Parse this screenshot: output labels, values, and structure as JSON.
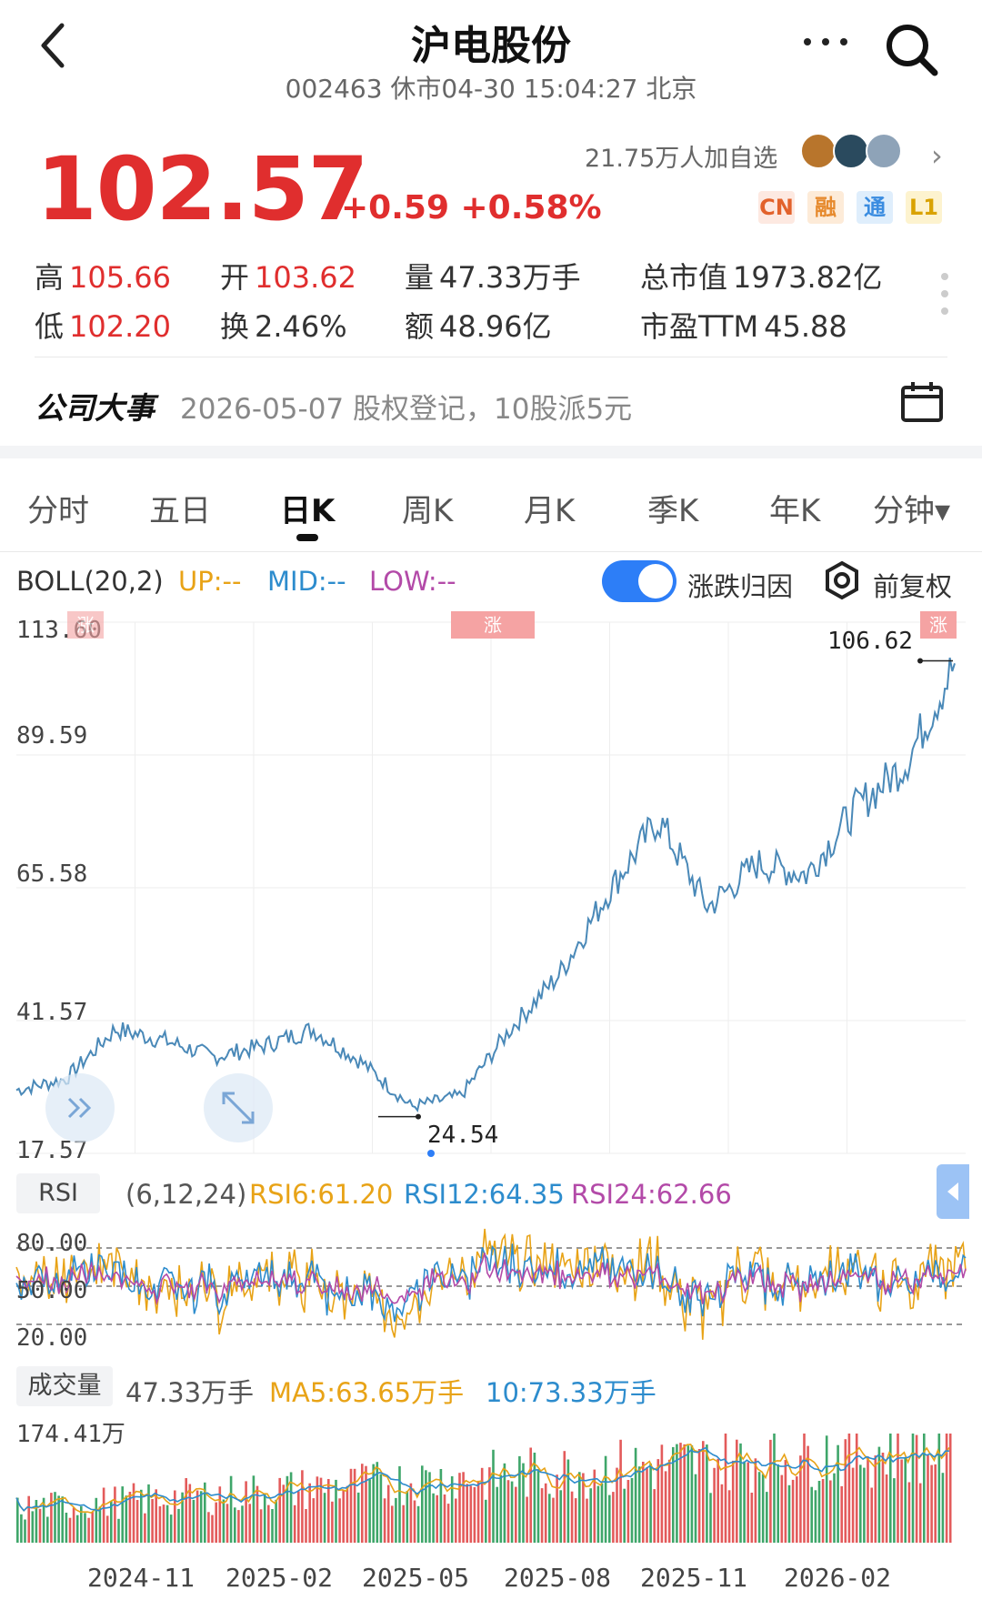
{
  "header": {
    "title": "沪电股份",
    "subtitle": "002463 休市04-30 15:04:27 北京"
  },
  "quote": {
    "price": "102.57",
    "change": "+0.59 +0.58%",
    "followers": "21.75万人加自选",
    "badges": [
      "CN",
      "融",
      "通",
      "L1"
    ]
  },
  "stats": {
    "high_label": "高",
    "high": "105.66",
    "low_label": "低",
    "low": "102.20",
    "open_label": "开",
    "open": "103.62",
    "turnover_label": "换",
    "turnover": "2.46%",
    "volume_label": "量",
    "volume": "47.33万手",
    "amount_label": "额",
    "amount": "48.96亿",
    "mktcap_label": "总市值",
    "mktcap": "1973.82亿",
    "pe_label": "市盈TTM",
    "pe": "45.88"
  },
  "event": {
    "label": "公司大事",
    "text": "2026-05-07 股权登记，10股派5元"
  },
  "tabs": [
    {
      "label": "分时"
    },
    {
      "label": "五日"
    },
    {
      "label": "日K"
    },
    {
      "label": "周K"
    },
    {
      "label": "月K"
    },
    {
      "label": "季K"
    },
    {
      "label": "年K"
    },
    {
      "label": "分钟▾"
    }
  ],
  "boll": {
    "name": "BOLL(20,2)",
    "up": "UP:--",
    "mid": "MID:--",
    "low": "LOW:--",
    "toggle_label": "涨跌归因",
    "adjust_label": "前复权"
  },
  "colors": {
    "price_up": "#e02e2e",
    "line": "#4a89b8",
    "up_bar": "#e35b5b",
    "down_bar": "#3fa66a",
    "ma_yellow": "#e8a317",
    "ma_blue": "#2d8ccd",
    "ma_purple": "#b34aa8"
  },
  "price_chart": {
    "y_ticks": [
      "113.60",
      "89.59",
      "65.58",
      "41.57",
      "17.57"
    ],
    "max_label": "106.62",
    "min_label": "24.54",
    "tag_label": "涨"
  },
  "rsi": {
    "label": "RSI",
    "params": "(6,12,24)",
    "rsi6": "RSI6:61.20",
    "rsi12": "RSI12:64.35",
    "rsi24": "RSI24:62.66",
    "levels": [
      "80.00",
      "50.00",
      "20.00"
    ]
  },
  "volume": {
    "label": "成交量",
    "value": "47.33万手",
    "ma5": "MA5:63.65万手",
    "ma10": "10:73.33万手",
    "max": "174.41万"
  },
  "x_labels": [
    "2024-11",
    "2025-02",
    "2025-05",
    "2025-08",
    "2025-11",
    "2026-02"
  ],
  "chart_data": {
    "type": "line",
    "title": "",
    "x": [
      "2024-09",
      "2024-10",
      "2024-11",
      "2024-12",
      "2025-01",
      "2025-02",
      "2025-03",
      "2025-04",
      "2025-05",
      "2025-06",
      "2025-07",
      "2025-08",
      "2025-09",
      "2025-10",
      "2025-11",
      "2025-12",
      "2026-01",
      "2026-02",
      "2026-03",
      "2026-04"
    ],
    "series": [
      {
        "values": [
          29,
          31,
          40,
          38,
          35,
          37,
          40,
          34,
          26,
          28,
          40,
          50,
          65,
          78,
          62,
          70,
          68,
          80,
          88,
          106
        ]
      }
    ],
    "ylim": [
      17.57,
      113.6
    ],
    "max_point": 106.62,
    "min_point": 24.54
  }
}
